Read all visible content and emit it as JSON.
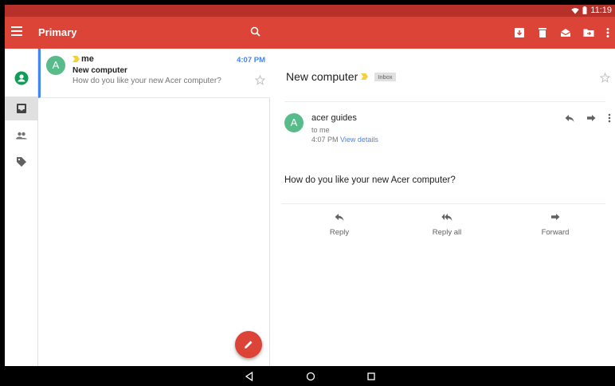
{
  "status_bar": {
    "time": "11:19"
  },
  "app_bar": {
    "title": "Primary"
  },
  "rail": {
    "items": [
      {
        "icon": "account-circle-icon"
      },
      {
        "icon": "inbox-icon",
        "selected": true
      },
      {
        "icon": "people-icon"
      },
      {
        "icon": "label-icon"
      }
    ]
  },
  "thread_list": [
    {
      "avatar_letter": "A",
      "sender": "me",
      "time": "4:07 PM",
      "subject": "New computer",
      "snippet": "How do you like your new Acer computer?"
    }
  ],
  "reading": {
    "subject": "New computer",
    "label": "Inbox",
    "avatar_letter": "A",
    "sender": "acer guides",
    "to": "to me",
    "time": "4:07 PM",
    "view_details": "View details",
    "body": "How do you like your new Acer computer?",
    "actions": {
      "reply": "Reply",
      "reply_all": "Reply all",
      "forward": "Forward"
    }
  },
  "colors": {
    "accent": "#db4437",
    "status_bar": "#b8302a",
    "link": "#4285f4",
    "avatar": "#57bb8a",
    "important": "#f4d03f"
  }
}
